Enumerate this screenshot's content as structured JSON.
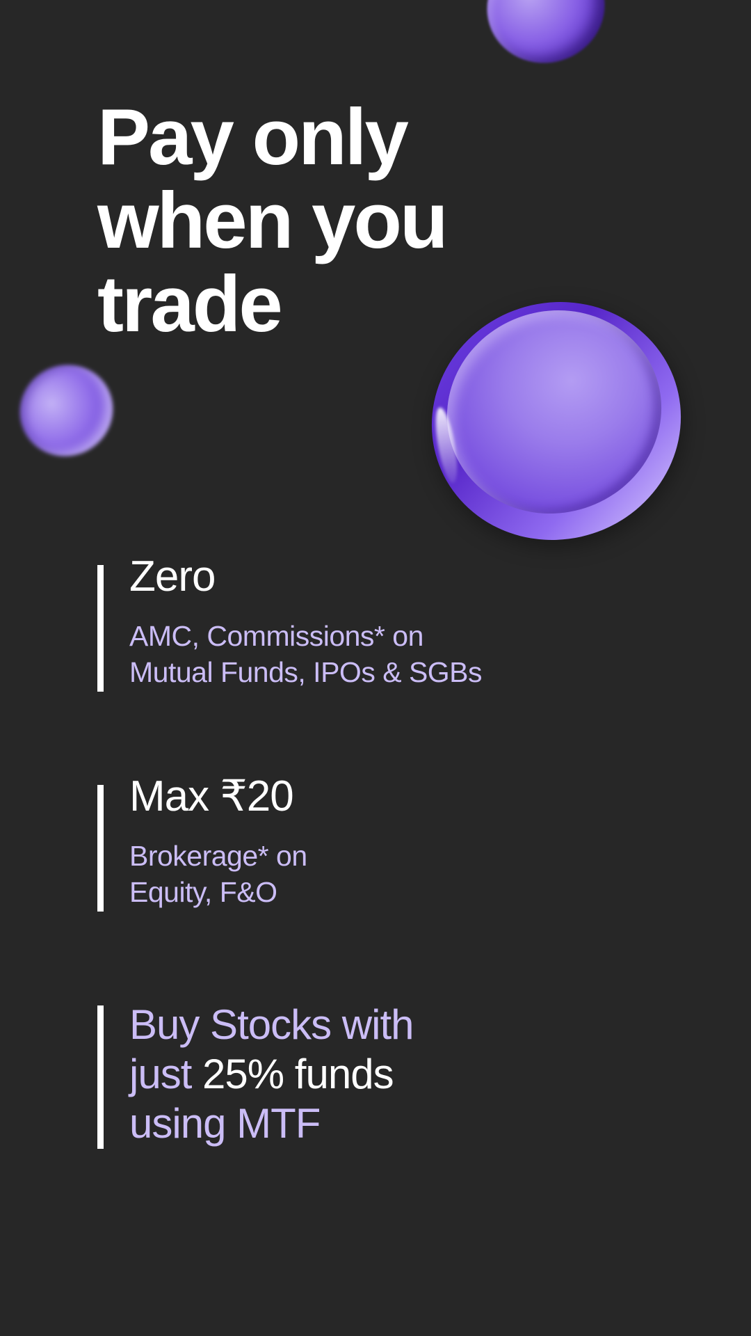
{
  "headline": {
    "line1": "Pay only",
    "line2": "when you",
    "line3": "trade"
  },
  "features": [
    {
      "title": "Zero",
      "desc_line1": "AMC, Commissions* on",
      "desc_line2": "Mutual Funds, IPOs & SGBs"
    },
    {
      "title": "Max ₹20",
      "desc_line1": "Brokerage* on",
      "desc_line2": "Equity, F&O"
    }
  ],
  "mtf": {
    "line1": "Buy Stocks with",
    "line2_lead": "just",
    "line2_highlight": "25% funds",
    "line3": "using MTF"
  },
  "colors": {
    "background": "#272727",
    "accent_lavender": "#cbbdf6",
    "coin_purple": "#7a52e0",
    "text_white": "#ffffff"
  },
  "decor": {
    "coin_icon": "purple-coin-icon"
  }
}
